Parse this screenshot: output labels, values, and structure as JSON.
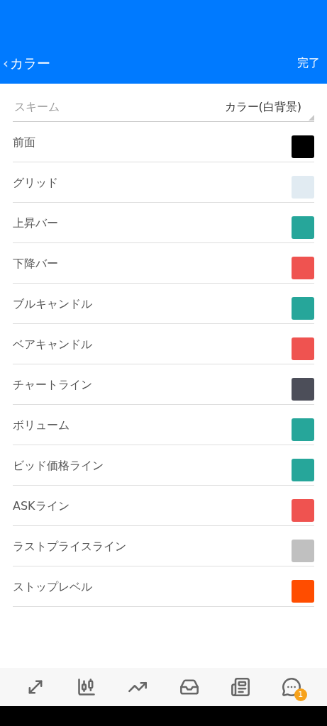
{
  "header": {
    "back_icon": "‹",
    "title": "カラー",
    "done": "完了"
  },
  "scheme": {
    "label": "スキーム",
    "value": "カラー(白背景)"
  },
  "colors": [
    {
      "label": "前面",
      "color": "#000000"
    },
    {
      "label": "グリッド",
      "color": "#e1ebf2"
    },
    {
      "label": "上昇バー",
      "color": "#26a69a"
    },
    {
      "label": "下降バー",
      "color": "#ef5350"
    },
    {
      "label": "ブルキャンドル",
      "color": "#26a69a"
    },
    {
      "label": "ベアキャンドル",
      "color": "#ef5350"
    },
    {
      "label": "チャートライン",
      "color": "#4c4e59"
    },
    {
      "label": "ボリューム",
      "color": "#26a69a"
    },
    {
      "label": "ビッド価格ライン",
      "color": "#26a69a"
    },
    {
      "label": "ASKライン",
      "color": "#ef5350"
    },
    {
      "label": "ラストプライスライン",
      "color": "#c0c0c0"
    },
    {
      "label": "ストップレベル",
      "color": "#ff4d00"
    }
  ],
  "tabbar": [
    {
      "kind": "trade"
    },
    {
      "kind": "chart"
    },
    {
      "kind": "trend"
    },
    {
      "kind": "inbox"
    },
    {
      "kind": "news"
    },
    {
      "kind": "chat",
      "badge": "1"
    }
  ]
}
